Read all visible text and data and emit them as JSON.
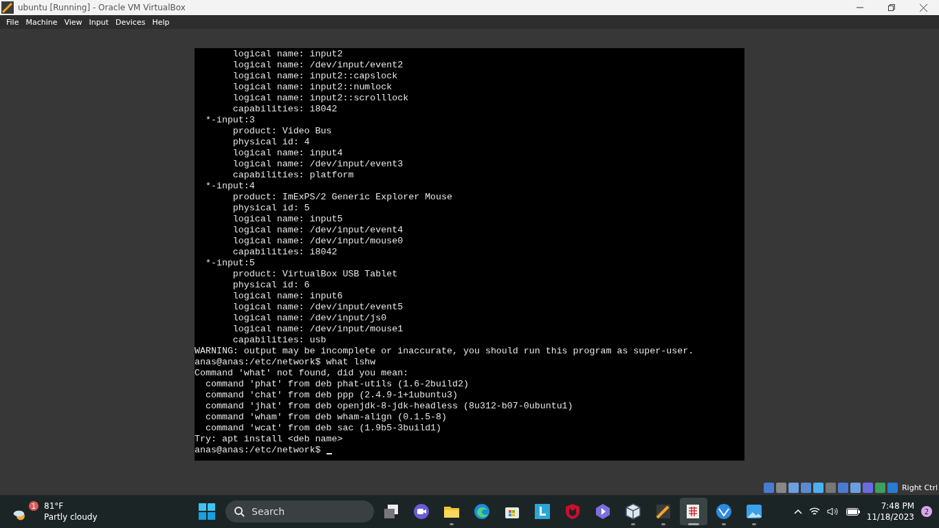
{
  "window": {
    "title": "ubuntu [Running] - Oracle VM VirtualBox"
  },
  "menu": [
    "File",
    "Machine",
    "View",
    "Input",
    "Devices",
    "Help"
  ],
  "terminal": {
    "lines": [
      "       logical name: input2",
      "       logical name: /dev/input/event2",
      "       logical name: input2::capslock",
      "       logical name: input2::numlock",
      "       logical name: input2::scrolllock",
      "       capabilities: i8042",
      "  *-input:3",
      "       product: Video Bus",
      "       physical id: 4",
      "       logical name: input4",
      "       logical name: /dev/input/event3",
      "       capabilities: platform",
      "  *-input:4",
      "       product: ImExPS/2 Generic Explorer Mouse",
      "       physical id: 5",
      "       logical name: input5",
      "       logical name: /dev/input/event4",
      "       logical name: /dev/input/mouse0",
      "       capabilities: i8042",
      "  *-input:5",
      "       product: VirtualBox USB Tablet",
      "       physical id: 6",
      "       logical name: input6",
      "       logical name: /dev/input/event5",
      "       logical name: /dev/input/js0",
      "       logical name: /dev/input/mouse1",
      "       capabilities: usb",
      "WARNING: output may be incomplete or inaccurate, you should run this program as super-user.",
      "anas@anas:/etc/network$ what lshw",
      "Command 'what' not found, did you mean:",
      "  command 'phat' from deb phat-utils (1.6-2build2)",
      "  command 'chat' from deb ppp (2.4.9-1+1ubuntu3)",
      "  command 'jhat' from deb openjdk-8-jdk-headless (8u312-b07-0ubuntu1)",
      "  command 'wham' from deb wham-align (0.1.5-8)",
      "  command 'wcat' from deb sac (1.9b5-3build1)",
      "Try: apt install <deb name>",
      "anas@anas:/etc/network$ "
    ],
    "cursor": true
  },
  "status_bar": {
    "host_key": "Right Ctrl"
  },
  "taskbar": {
    "weather": {
      "temperature": "81°F",
      "condition": "Partly cloudy",
      "badge": "1"
    },
    "search": {
      "placeholder": "Search"
    },
    "apps": [
      {
        "kind": "taskview",
        "running": false,
        "active": false
      },
      {
        "kind": "chat",
        "running": false,
        "active": false
      },
      {
        "kind": "folder",
        "running": true,
        "active": false
      },
      {
        "kind": "edge",
        "running": false,
        "active": false
      },
      {
        "kind": "store",
        "running": false,
        "active": false
      },
      {
        "kind": "letter",
        "running": false,
        "active": false
      },
      {
        "kind": "shield",
        "running": false,
        "active": false
      },
      {
        "kind": "hex",
        "running": false,
        "active": false
      },
      {
        "kind": "cube",
        "running": true,
        "active": false
      },
      {
        "kind": "vbox",
        "running": true,
        "active": false
      },
      {
        "kind": "sheet",
        "running": true,
        "active": true
      },
      {
        "kind": "globe",
        "running": true,
        "active": false
      },
      {
        "kind": "photos",
        "running": true,
        "active": false
      }
    ],
    "time": "7:48 PM",
    "date": "11/18/2023",
    "notifications": "2"
  }
}
